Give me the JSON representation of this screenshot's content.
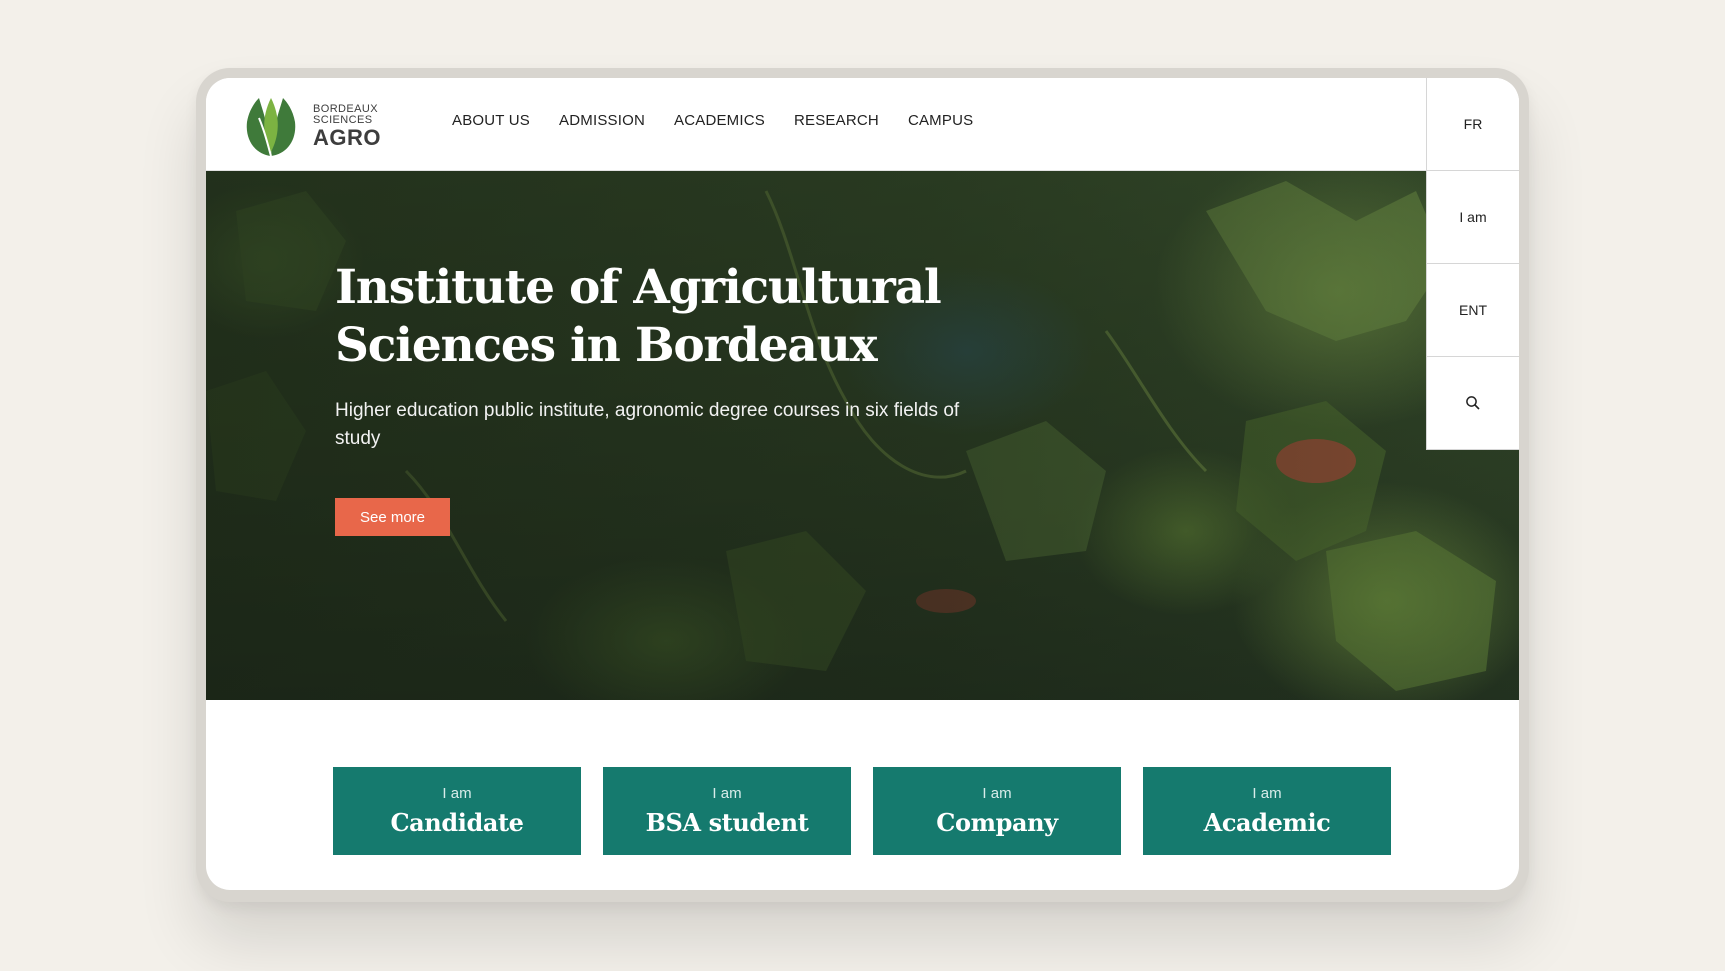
{
  "logo": {
    "line1": "BORDEAUX",
    "line2": "SCIENCES",
    "line3": "AGRO",
    "icon": "sprout-leaf-icon",
    "colors": {
      "leaf_light": "#7cb342",
      "leaf_dark": "#3f7a3a"
    }
  },
  "nav": {
    "items": [
      {
        "label": "ABOUT US"
      },
      {
        "label": "ADMISSION"
      },
      {
        "label": "ACADEMICS"
      },
      {
        "label": "RESEARCH"
      },
      {
        "label": "CAMPUS"
      }
    ]
  },
  "side": {
    "language": "FR",
    "iam": "I am",
    "ent": "ENT",
    "search_icon": "search-icon"
  },
  "hero": {
    "title": "Institute of Agricultural Sciences in Bordeaux",
    "subtitle": "Higher education public institute, agronomic degree courses in six fields of study",
    "cta": "See more"
  },
  "cards": [
    {
      "pre": "I am",
      "label": "Candidate"
    },
    {
      "pre": "I am",
      "label": "BSA student"
    },
    {
      "pre": "I am",
      "label": "Company"
    },
    {
      "pre": "I am",
      "label": "Academic"
    }
  ],
  "colors": {
    "accent": "#e8674a",
    "card": "#157a6e",
    "background": "#f3f0ea"
  }
}
